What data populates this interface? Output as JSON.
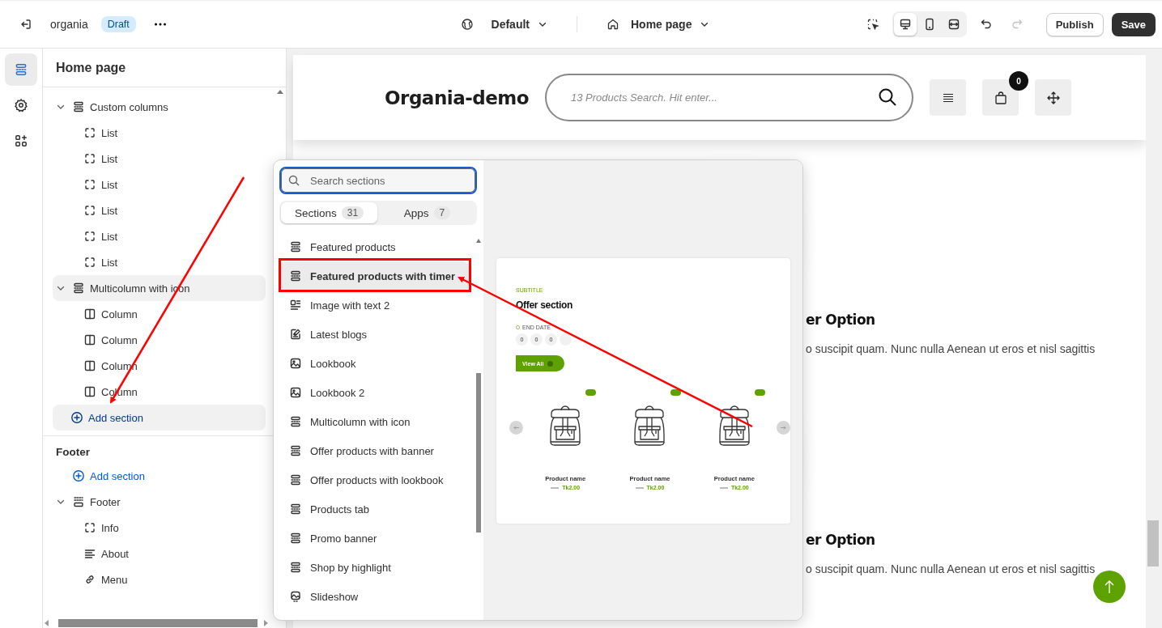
{
  "topbar": {
    "store_name": "organia",
    "status_badge": "Draft",
    "theme_selector": "Default",
    "page_selector": "Home page",
    "devices": [
      {
        "kind": "desktop",
        "selected": true
      },
      {
        "kind": "mobile",
        "selected": false
      },
      {
        "kind": "fullwidth",
        "selected": false
      }
    ],
    "redo_disabled": true,
    "publish": "Publish",
    "save": "Save"
  },
  "rail": [
    {
      "kind": "sections",
      "selected": true
    },
    {
      "kind": "settings",
      "selected": false
    },
    {
      "kind": "apps",
      "selected": false
    }
  ],
  "sidebar": {
    "title": "Home page",
    "tree": [
      {
        "label": "Custom columns",
        "kind": "section",
        "expanded": true,
        "selected": false,
        "children": [
          {
            "label": "List",
            "kind": "block"
          },
          {
            "label": "List",
            "kind": "block"
          },
          {
            "label": "List",
            "kind": "block"
          },
          {
            "label": "List",
            "kind": "block"
          },
          {
            "label": "List",
            "kind": "block"
          },
          {
            "label": "List",
            "kind": "block"
          }
        ]
      },
      {
        "label": "Multicolumn with icon",
        "kind": "section",
        "expanded": true,
        "selected": true,
        "children": [
          {
            "label": "Column",
            "kind": "column"
          },
          {
            "label": "Column",
            "kind": "column"
          },
          {
            "label": "Column",
            "kind": "column"
          },
          {
            "label": "Column",
            "kind": "column"
          }
        ]
      }
    ],
    "add_section": {
      "label": "Add section",
      "selected": true
    },
    "footer_heading": "Footer",
    "footer_add_section": "Add section",
    "footer_tree": [
      {
        "label": "Footer",
        "kind": "footer",
        "expanded": true,
        "selected": false,
        "children": [
          {
            "label": "Info",
            "kind": "block"
          },
          {
            "label": "About",
            "kind": "text"
          },
          {
            "label": "Menu",
            "kind": "link"
          }
        ]
      }
    ]
  },
  "picker": {
    "search": {
      "placeholder": "Search sections"
    },
    "tabs": [
      {
        "label": "Sections",
        "count": "31",
        "selected": true
      },
      {
        "label": "Apps",
        "count": "7",
        "selected": false
      }
    ],
    "items": [
      {
        "label": "Featured products",
        "kind": "section",
        "selected": false
      },
      {
        "label": "Featured products with timer",
        "kind": "section",
        "selected": true
      },
      {
        "label": "Image with text 2",
        "kind": "image-text",
        "selected": false
      },
      {
        "label": "Latest blogs",
        "kind": "blog",
        "selected": false
      },
      {
        "label": "Lookbook",
        "kind": "image",
        "selected": false
      },
      {
        "label": "Lookbook 2",
        "kind": "image",
        "selected": false
      },
      {
        "label": "Multicolumn with icon",
        "kind": "section",
        "selected": false
      },
      {
        "label": "Offer products with banner",
        "kind": "section",
        "selected": false
      },
      {
        "label": "Offer products with lookbook",
        "kind": "section",
        "selected": false
      },
      {
        "label": "Products tab",
        "kind": "section",
        "selected": false
      },
      {
        "label": "Promo banner",
        "kind": "section",
        "selected": false
      },
      {
        "label": "Shop by highlight",
        "kind": "section",
        "selected": false
      },
      {
        "label": "Slideshow",
        "kind": "slideshow",
        "selected": false
      }
    ],
    "preview": {
      "subtitle": "SUBTITLE",
      "title": "Offer section",
      "countdown_label": "END DATE",
      "countdown": [
        "0",
        "0",
        "0"
      ],
      "button": "View All",
      "products": [
        {
          "name": "Product name",
          "price": "Tk2.00"
        },
        {
          "name": "Product name",
          "price": "Tk2.00"
        },
        {
          "name": "Product name",
          "price": "Tk2.00"
        }
      ]
    }
  },
  "storefront": {
    "logo": "Organia-demo",
    "search": {
      "placeholder": "13 Products Search. Hit enter..."
    },
    "cart_count": "0",
    "columns": [
      {
        "heading": "er Option",
        "text": "o suscipit quam. Nunc nulla Aenean ut eros et nisl sagittis"
      },
      {
        "heading": "er Option",
        "text": "o suscipit quam. Nunc nulla Aenean ut eros et nisl sagittis"
      }
    ]
  }
}
